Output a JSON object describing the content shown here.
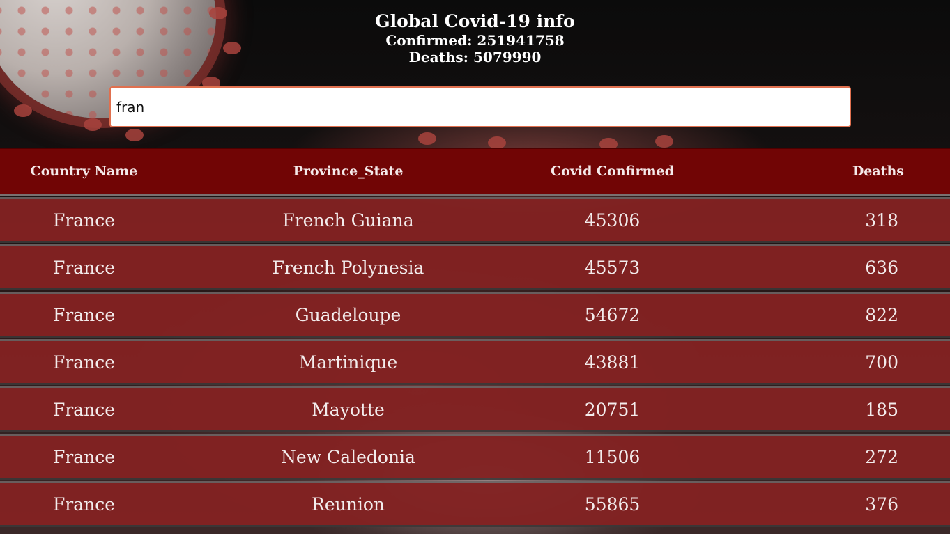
{
  "header": {
    "title": "Global Covid-19 info",
    "confirmed_text": "Confirmed: 251941758",
    "deaths_text": "Deaths: 5079990"
  },
  "search": {
    "value": "fran",
    "placeholder": ""
  },
  "table": {
    "columns": [
      "Country Name",
      "Province_State",
      "Covid Confirmed",
      "Deaths"
    ],
    "rows": [
      [
        "France",
        "French Guiana",
        "45306",
        "318"
      ],
      [
        "France",
        "French Polynesia",
        "45573",
        "636"
      ],
      [
        "France",
        "Guadeloupe",
        "54672",
        "822"
      ],
      [
        "France",
        "Martinique",
        "43881",
        "700"
      ],
      [
        "France",
        "Mayotte",
        "20751",
        "185"
      ],
      [
        "France",
        "New Caledonia",
        "11506",
        "272"
      ],
      [
        "France",
        "Reunion",
        "55865",
        "376"
      ]
    ]
  },
  "colors": {
    "header_bg": "#710505",
    "row_bg": "#822222",
    "search_border": "#e0704f",
    "page_bg": "#0b0b0b"
  }
}
